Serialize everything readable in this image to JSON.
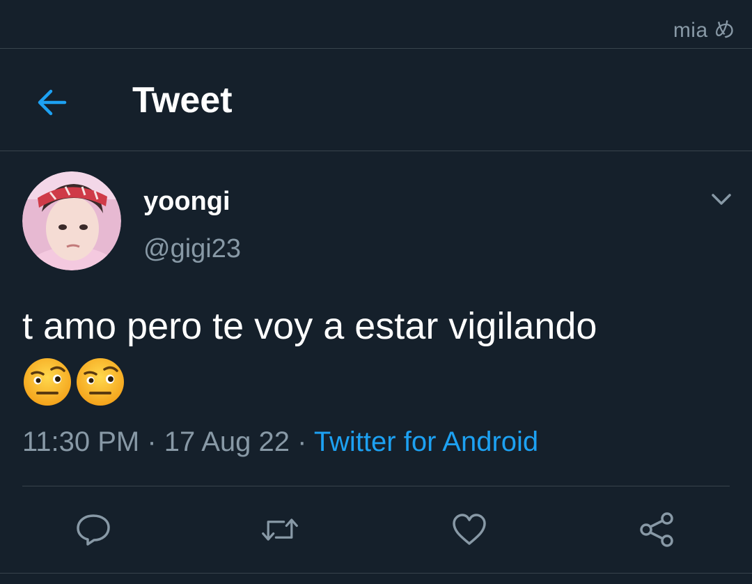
{
  "watermark": "mia め",
  "header": {
    "title": "Tweet",
    "back_icon": "arrow-left-icon"
  },
  "tweet": {
    "display_name": "yoongi",
    "handle": "@gigi23",
    "text": "t amo pero te voy a estar vigilando",
    "emojis": [
      "face-with-raised-eyebrow-emoji",
      "face-with-raised-eyebrow-emoji"
    ],
    "time": "11:30 PM",
    "date": "17 Aug 22",
    "source": "Twitter for Android",
    "separator": " · "
  },
  "actions": [
    {
      "name": "reply",
      "icon": "comment-icon"
    },
    {
      "name": "retweet",
      "icon": "retweet-icon"
    },
    {
      "name": "like",
      "icon": "heart-icon"
    },
    {
      "name": "share",
      "icon": "share-icon"
    }
  ],
  "colors": {
    "background": "#15202b",
    "divider": "#38444d",
    "muted": "#8899a6",
    "accent": "#1da1f2",
    "text": "#ffffff"
  }
}
